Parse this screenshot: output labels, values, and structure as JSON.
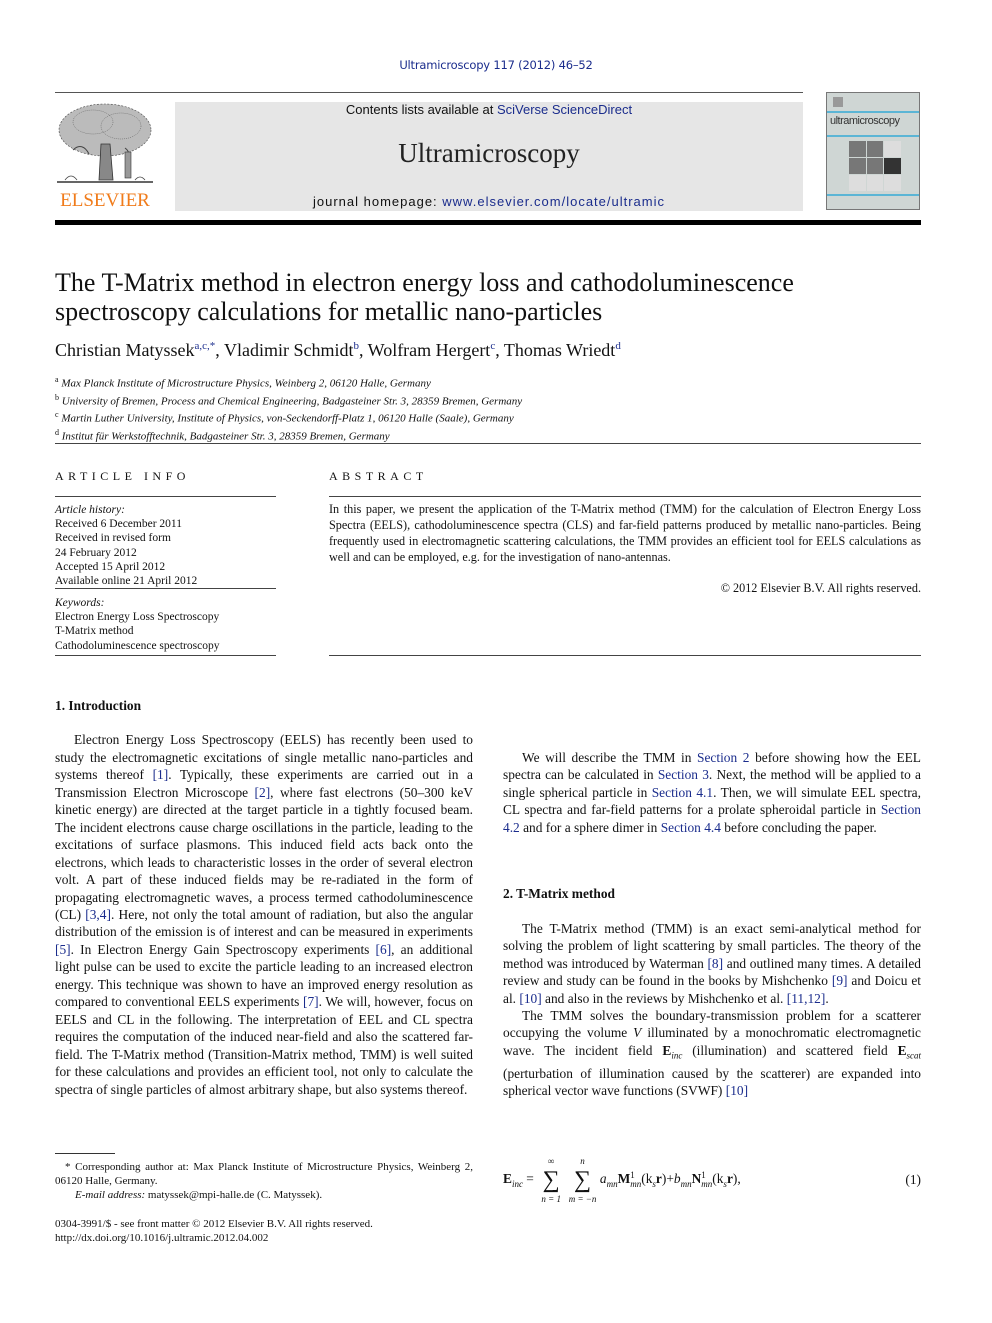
{
  "header": {
    "citation": "Ultramicroscopy 117 (2012) 46–52",
    "contents_prefix": "Contents lists available at ",
    "contents_link": "SciVerse ScienceDirect",
    "journal_title": "Ultramicroscopy",
    "homepage_prefix": "journal homepage: ",
    "homepage_link": "www.elsevier.com/locate/ultramic",
    "publisher_logo_text": "ELSEVIER",
    "cover_title": "ultramicroscopy",
    "colors": {
      "link": "#1a2c8c",
      "elsevier_orange": "#f07b1a",
      "banner_bg": "#e6e6e6"
    }
  },
  "article": {
    "title": "The T-Matrix method in electron energy loss and cathodoluminescence spectroscopy calculations for metallic nano-particles",
    "authors": [
      {
        "name": "Christian Matyssek",
        "sup": "a,c,",
        "star": "*"
      },
      {
        "name": "Vladimir Schmidt",
        "sup": "b"
      },
      {
        "name": "Wolfram Hergert",
        "sup": "c"
      },
      {
        "name": "Thomas Wriedt",
        "sup": "d"
      }
    ],
    "affiliations": [
      {
        "key": "a",
        "text": "Max Planck Institute of Microstructure Physics, Weinberg 2, 06120 Halle, Germany"
      },
      {
        "key": "b",
        "text": "University of Bremen, Process and Chemical Engineering, Badgasteiner Str. 3, 28359 Bremen, Germany"
      },
      {
        "key": "c",
        "text": "Martin Luther University, Institute of Physics, von-Seckendorff-Platz 1, 06120 Halle (Saale), Germany"
      },
      {
        "key": "d",
        "text": "Institut für Werkstofftechnik, Badgasteiner Str. 3, 28359 Bremen, Germany"
      }
    ]
  },
  "article_info": {
    "heading": "ARTICLE INFO",
    "history_label": "Article history:",
    "history": [
      "Received 6 December 2011",
      "Received in revised form",
      "24 February 2012",
      "Accepted 15 April 2012",
      "Available online 21 April 2012"
    ],
    "keywords_label": "Keywords:",
    "keywords": [
      "Electron Energy Loss Spectroscopy",
      "T-Matrix method",
      "Cathodoluminescence spectroscopy"
    ]
  },
  "abstract": {
    "heading": "ABSTRACT",
    "text": "In this paper, we present the application of the T-Matrix method (TMM) for the calculation of Electron Energy Loss Spectra (EELS), cathodoluminescence spectra (CLS) and far-field patterns produced by metallic nano-particles. Being frequently used in electromagnetic scattering calculations, the TMM provides an efficient tool for EELS calculations as well and can be employed, e.g. for the investigation of nano-antennas.",
    "copyright": "© 2012 Elsevier B.V. All rights reserved."
  },
  "sections": {
    "intro": {
      "heading": "1.  Introduction",
      "p1": [
        "Electron Energy Loss Spectroscopy (EELS) has recently been used to study the electromagnetic excitations of single metallic nano-particles and systems thereof ",
        "[1]",
        ". Typically, these experiments are carried out in a Transmission Electron Microscope ",
        "[2]",
        ", where fast electrons (50–300 keV kinetic energy) are directed at the target particle in a tightly focused beam. The incident electrons cause charge oscillations in the particle, leading to the excitations of surface plasmons. This induced field acts back onto the electrons, which leads to characteristic losses in the order of several electron volt. A part of these induced fields may be re-radiated in the form of propagating electromagnetic waves, a process termed cathodoluminescence (CL) ",
        "[3,4]",
        ". Here, not only the total amount of radiation, but also the angular distribution of the emission is of interest and can be measured in experiments ",
        "[5]",
        ". In Electron Energy Gain Spectroscopy experiments ",
        "[6]",
        ", an additional light pulse can be used to excite the particle leading to an increased electron energy. This technique was shown to have an improved energy resolution as compared to conventional EELS experiments ",
        "[7]",
        ". We will, however, focus on EELS and CL in the following. The interpretation of EEL and CL spectra requires the computation of the induced near-field and also the scattered far-field. The T-Matrix method (Transition-Matrix method, TMM) is well suited for these calculations and provides an efficient tool, not only to calculate the spectra of single particles of almost arbitrary shape, but also systems thereof."
      ],
      "p2": [
        "We will describe the TMM in ",
        "Section 2",
        " before showing how the EEL spectra can be calculated in ",
        "Section 3",
        ". Next, the method will be applied to a single spherical particle in ",
        "Section 4.1",
        ". Then, we will simulate EEL spectra, CL spectra and far-field patterns for a prolate spheroidal particle in ",
        "Section 4.2",
        " and for a sphere dimer in ",
        "Section 4.4",
        " before concluding the paper."
      ]
    },
    "tmatrix": {
      "heading": "2.  T-Matrix method",
      "p1": [
        "The T-Matrix method (TMM) is an exact semi-analytical method for solving the problem of light scattering by small particles. The theory of the method was introduced by Waterman ",
        "[8]",
        " and outlined many times. A detailed review and study can be found in the books by Mishchenko ",
        "[9]",
        " and Doicu et al. ",
        "[10]",
        " and also in the reviews by Mishchenko et al. ",
        "[11,12]",
        "."
      ],
      "p2": [
        "The TMM solves the boundary-transmission problem for a scatterer occupying the volume ",
        "V",
        " illuminated by a monochromatic electromagnetic wave. The incident field ",
        "E_inc",
        " (illumination) and scattered field ",
        "E_scat",
        " (perturbation of illumination caused by the scatterer) are expanded into spherical vector wave functions (SVWF) ",
        "[10]"
      ],
      "equation": {
        "lhs": "E",
        "lhs_sub": "inc",
        "sum1_upper": "∞",
        "sum1_lower": "n = 1",
        "sum2_upper": "n",
        "sum2_lower": "m = −n",
        "term1": "a",
        "term1_sub": "mn",
        "M": "M",
        "M_sup": "1",
        "M_sub": "mn",
        "arg": "(k",
        "arg_sub": "s",
        "arg_r": "r",
        "term2": "b",
        "term2_sub": "mn",
        "N": "N",
        "N_sup": "1",
        "N_sub": "mn",
        "number": "(1)"
      }
    }
  },
  "footnotes": {
    "corresponding": "* Corresponding author at: Max Planck Institute of Microstructure Physics, Weinberg 2, 06120 Halle, Germany.",
    "email_label": "E-mail address:",
    "email": " matyssek@mpi-halle.de (C. Matyssek).",
    "issn": "0304-3991/$ - see front matter © 2012 Elsevier B.V. All rights reserved.",
    "doi": "http://dx.doi.org/10.1016/j.ultramic.2012.04.002"
  }
}
